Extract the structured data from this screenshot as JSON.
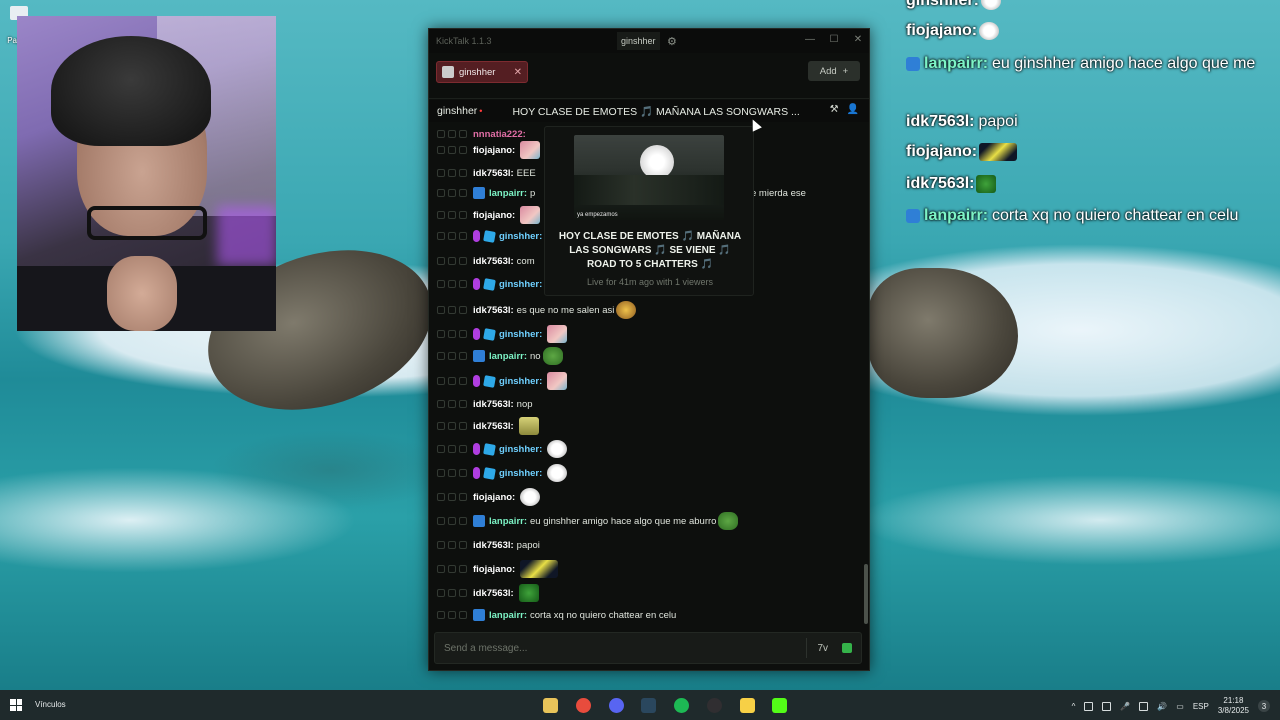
{
  "desktop": {
    "icon_label": "Pap\nre"
  },
  "overlay_chat": [
    {
      "user": "ginshher:",
      "msg": "",
      "y": 0
    },
    {
      "user": "fiojajano:",
      "msg": "",
      "y": 0
    },
    {
      "user": "lanpairr:",
      "msg": "eu ginshher amigo hace algo que me",
      "y": 0
    },
    {
      "user": "idk7563l:",
      "msg": "papoi",
      "y": 0
    },
    {
      "user": "fiojajano:",
      "msg": "",
      "y": 0
    },
    {
      "user": "idk7563l:",
      "msg": "",
      "y": 0
    },
    {
      "user": "lanpairr:",
      "msg": "corta xq no quiero chattear en celu",
      "y": 0
    }
  ],
  "window": {
    "app_title": "KickTalk 1.1.3",
    "current_user": "ginshher",
    "minimize": "—",
    "maximize": "☐",
    "close": "✕"
  },
  "tabs": {
    "items": [
      {
        "label": "ginshher"
      }
    ],
    "add_label": "Add"
  },
  "channel": {
    "name": "ginshher",
    "title": "HOY CLASE DE EMOTES 🎵 MAÑANA LAS SONGWARS ...",
    "live_indicator": "•"
  },
  "messages": [
    {
      "user": "nnnatia222:",
      "color": "#e06ea5",
      "text": "",
      "emote": "",
      "badges": []
    },
    {
      "user": "fiojajano:",
      "color": "#ffffff",
      "text": "",
      "emote": "pink",
      "badges": []
    },
    {
      "user": "idk7563l:",
      "color": "#ffffff",
      "text": "EEE",
      "emote": "",
      "badges": []
    },
    {
      "user": "lanpairr:",
      "color": "#7df4c6",
      "text": "p",
      "emote": "",
      "badges": [
        "bot"
      ],
      "tail": "e mierda ese"
    },
    {
      "user": "fiojajano:",
      "color": "#ffffff",
      "text": "",
      "emote": "pink",
      "badges": []
    },
    {
      "user": "ginshher:",
      "color": "#6fd0ff",
      "text": "",
      "emote": "pink",
      "badges": [
        "mic",
        "cube"
      ]
    },
    {
      "user": "idk7563l:",
      "color": "#ffffff",
      "text": "com",
      "emote": "",
      "badges": []
    },
    {
      "user": "ginshher:",
      "color": "#6fd0ff",
      "text": "",
      "emote": "pink",
      "badges": [
        "mic",
        "cube"
      ]
    },
    {
      "user": "idk7563l:",
      "color": "#ffffff",
      "text": "es que no me salen asi",
      "emote": "nerd",
      "badges": []
    },
    {
      "user": "ginshher:",
      "color": "#6fd0ff",
      "text": "",
      "emote": "pink",
      "badges": [
        "mic",
        "cube"
      ]
    },
    {
      "user": "lanpairr:",
      "color": "#7df4c6",
      "text": "no",
      "emote": "pepe",
      "badges": [
        "bot"
      ]
    },
    {
      "user": "ginshher:",
      "color": "#6fd0ff",
      "text": "",
      "emote": "pink",
      "badges": [
        "mic",
        "cube"
      ]
    },
    {
      "user": "idk7563l:",
      "color": "#ffffff",
      "text": "nop",
      "emote": "",
      "badges": []
    },
    {
      "user": "idk7563l:",
      "color": "#ffffff",
      "text": "",
      "emote": "sponge",
      "badges": []
    },
    {
      "user": "ginshher:",
      "color": "#6fd0ff",
      "text": "",
      "emote": "troll",
      "badges": [
        "mic",
        "cube"
      ]
    },
    {
      "user": "ginshher:",
      "color": "#6fd0ff",
      "text": "",
      "emote": "troll",
      "badges": [
        "mic",
        "cube"
      ]
    },
    {
      "user": "fiojajano:",
      "color": "#ffffff",
      "text": "",
      "emote": "troll",
      "badges": []
    },
    {
      "user": "lanpairr:",
      "color": "#7df4c6",
      "text": "eu ginshher amigo hace algo que me aburro",
      "emote": "pepe",
      "badges": [
        "bot"
      ]
    },
    {
      "user": "idk7563l:",
      "color": "#ffffff",
      "text": "papoi",
      "emote": "",
      "badges": []
    },
    {
      "user": "fiojajano:",
      "color": "#ffffff",
      "text": "",
      "emote": "lambo",
      "badges": []
    },
    {
      "user": "idk7563l:",
      "color": "#ffffff",
      "text": "",
      "emote": "frog",
      "badges": []
    },
    {
      "user": "lanpairr:",
      "color": "#7df4c6",
      "text": "corta xq no quiero chattear en celu",
      "emote": "",
      "badges": [
        "bot"
      ]
    }
  ],
  "preview": {
    "thumb_caption": "ya empezamos",
    "title": "HOY CLASE DE EMOTES 🎵 MAÑANA LAS SONGWARS 🎵 SE VIENE 🎵 ROAD TO 5 CHATTERS 🎵",
    "stats": "Live for 41m ago with 1 viewers"
  },
  "input": {
    "placeholder": "Send a message..."
  },
  "taskbar": {
    "vinculos": "Vínculos",
    "lang": "ESP",
    "time": "21:18",
    "date": "3/8/2025",
    "notification_count": "3",
    "apps": [
      "files",
      "chrome",
      "discord",
      "steam",
      "spotify",
      "obs",
      "notes",
      "kick"
    ]
  },
  "colors": {
    "kick_green": "#53fc18",
    "tab_red": "#541e22",
    "live_red": "#ff3c3c"
  }
}
